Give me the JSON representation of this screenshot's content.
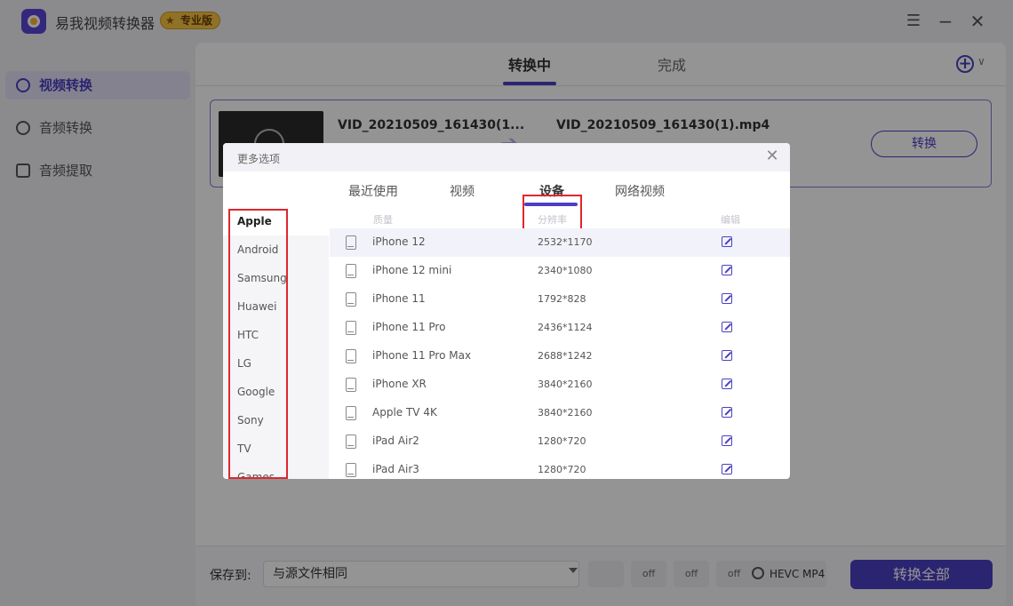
{
  "app": {
    "title": "易我视频转换器",
    "badge": "专业版",
    "window_buttons": {
      "menu": "☰",
      "minimize": "−",
      "close": "✕"
    }
  },
  "sidebar": {
    "items": [
      {
        "label": "视频转换",
        "icon": "video-convert-icon",
        "active": true
      },
      {
        "label": "音频转换",
        "icon": "audio-convert-icon",
        "active": false
      },
      {
        "label": "音频提取",
        "icon": "audio-extract-icon",
        "active": false
      }
    ]
  },
  "main": {
    "tabs": [
      {
        "label": "转换中",
        "active": true
      },
      {
        "label": "完成",
        "active": false
      }
    ],
    "add_button": "+",
    "add_caret": "∨",
    "file": {
      "source_name": "VID_20210509_161430(1...",
      "target_name": "VID_20210509_161430(1).mp4",
      "convert_label": "转换",
      "arrow": "➔"
    }
  },
  "bottom": {
    "save_label": "保存到:",
    "save_value": "与源文件相同",
    "speed_label": "off",
    "gpu_label": "off",
    "crop_label": "off",
    "format_label": "HEVC MP4",
    "convert_all_label": "转换全部"
  },
  "modal": {
    "title": "更多选项",
    "close": "✕",
    "tabs": [
      {
        "label": "最近使用",
        "active": false
      },
      {
        "label": "视频",
        "active": false
      },
      {
        "label": "设备",
        "active": true
      },
      {
        "label": "网络视频",
        "active": false
      }
    ],
    "brands": [
      "Apple",
      "Android",
      "Samsung",
      "Huawei",
      "HTC",
      "LG",
      "Google",
      "Sony",
      "TV",
      "Games"
    ],
    "active_brand": "Apple",
    "columns": {
      "quality": "质量",
      "resolution": "分辨率",
      "edit": "编辑"
    },
    "devices": [
      {
        "name": "iPhone 12",
        "resolution": "2532*1170"
      },
      {
        "name": "iPhone 12 mini",
        "resolution": "2340*1080"
      },
      {
        "name": "iPhone 11",
        "resolution": "1792*828"
      },
      {
        "name": "iPhone 11 Pro",
        "resolution": "2436*1124"
      },
      {
        "name": "iPhone 11 Pro Max",
        "resolution": "2688*1242"
      },
      {
        "name": "iPhone XR",
        "resolution": "3840*2160"
      },
      {
        "name": "Apple TV 4K",
        "resolution": "3840*2160"
      },
      {
        "name": "iPad Air2",
        "resolution": "1280*720"
      },
      {
        "name": "iPad Air3",
        "resolution": "1280*720"
      }
    ]
  },
  "colors": {
    "accent": "#4b3fc3",
    "highlight": "#e0262f",
    "badge": "#f6c445"
  }
}
